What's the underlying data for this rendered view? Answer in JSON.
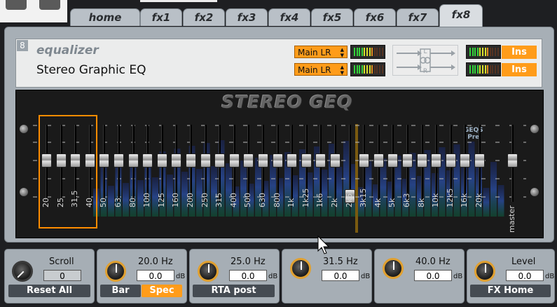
{
  "tabs": [
    {
      "label": "home",
      "active": false
    },
    {
      "label": "fx1",
      "active": false
    },
    {
      "label": "fx2",
      "active": false
    },
    {
      "label": "fx3",
      "active": false
    },
    {
      "label": "fx4",
      "active": false
    },
    {
      "label": "fx5",
      "active": false
    },
    {
      "label": "fx6",
      "active": false
    },
    {
      "label": "fx7",
      "active": false
    },
    {
      "label": "fx8",
      "active": true
    }
  ],
  "slot": {
    "number": "8",
    "type": "equalizer",
    "name": "Stereo Graphic EQ",
    "input_route": "Main LR",
    "output_route": "Main LR",
    "link_labels": {
      "l": "L",
      "r": "R"
    },
    "ins_top": "Ins",
    "ins_bottom": "Ins"
  },
  "eq": {
    "title": "STEREO GEQ",
    "badge_line1": "GEQS",
    "badge_line2": "Pre",
    "bands": [
      "20",
      "25",
      "31.5",
      "40",
      "50",
      "63",
      "80",
      "100",
      "125",
      "160",
      "200",
      "250",
      "315",
      "400",
      "500",
      "630",
      "800",
      "1k",
      "1k25",
      "1k6",
      "2k",
      "2k5",
      "3k15",
      "4k",
      "5k",
      "6k3",
      "8k",
      "10k",
      "12k5",
      "16k",
      "20k"
    ],
    "master_label": "master"
  },
  "controls": {
    "scroll": {
      "label": "Scroll",
      "value": "0",
      "button": "Reset All"
    },
    "p1": {
      "label": "20.0 Hz",
      "value": "0.0",
      "unit": "dB",
      "btn_a": "Bar",
      "btn_b": "Spec"
    },
    "p2": {
      "label": "25.0 Hz",
      "value": "0.0",
      "unit": "dB",
      "button": "RTA post"
    },
    "p3": {
      "label": "31.5 Hz",
      "value": "0.0",
      "unit": "dB"
    },
    "p4": {
      "label": "40.0 Hz",
      "value": "0.0",
      "unit": "dB"
    },
    "level": {
      "label": "Level",
      "value": "0.0",
      "unit": "dB",
      "button": "FX Home"
    }
  },
  "colors": {
    "accent": "#ff9c1a",
    "panel": "#a7afb6",
    "selection": "#ff8c00"
  }
}
